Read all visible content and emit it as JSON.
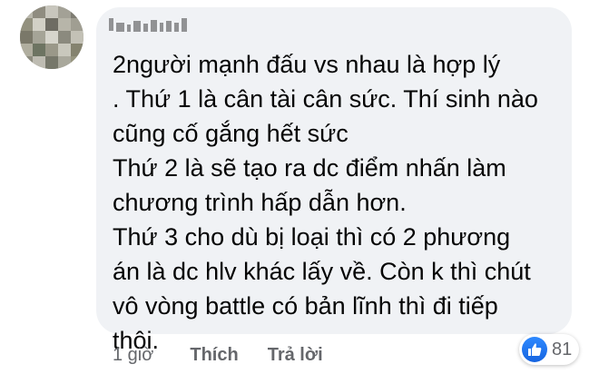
{
  "comment": {
    "text": "2người mạnh đấu vs nhau là hợp lý\n. Thứ 1 là cân tài cân sức. Thí sinh nào\ncũng cố gắng hết sức\nThứ 2 là sẽ tạo ra dc điểm nhấn làm\nchương trình hấp dẫn hơn.\nThứ 3 cho dù bị loại thì có 2 phương\nán là dc hlv khác lấy về. Còn k thì chút\nvô vòng battle có bản lĩnh thì đi tiếp\nthôi."
  },
  "actions": {
    "time": "1 giờ",
    "like_label": "Thích",
    "reply_label": "Trả lời"
  },
  "reactions": {
    "icon": "like-icon",
    "count": "81"
  },
  "colors": {
    "bubble": "#f0f2f5",
    "text": "#050505",
    "meta": "#65676b",
    "like_blue": "#1877f2"
  }
}
